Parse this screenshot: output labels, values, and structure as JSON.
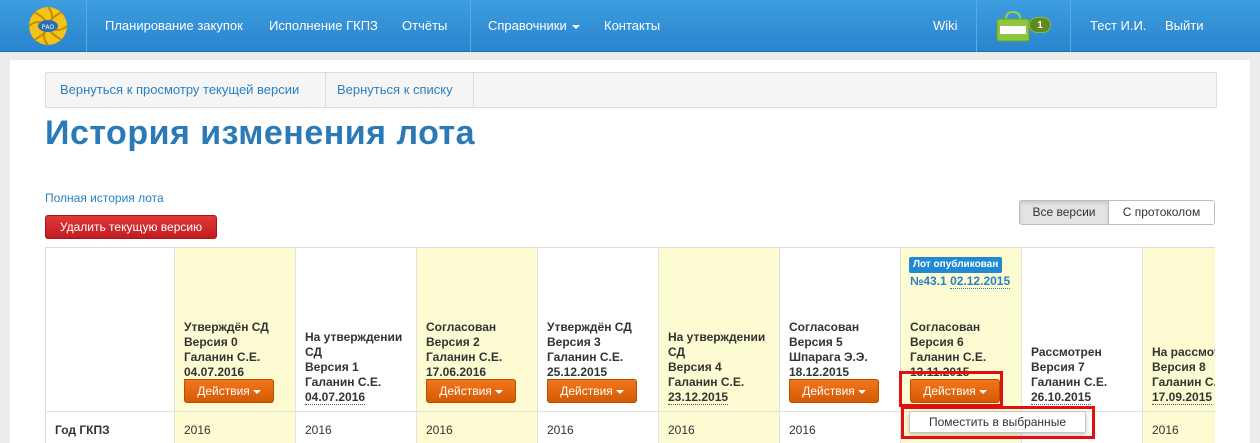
{
  "nav": {
    "items": [
      "Планирование закупок",
      "Исполнение ГКПЗ",
      "Отчёты",
      "Справочники",
      "Контакты"
    ],
    "wiki": "Wiki",
    "cart_count": "1",
    "user": "Тест И.И.",
    "logout": "Выйти",
    "colors": {
      "bar": "#2a85cc",
      "accent": "#5f8a1f"
    }
  },
  "breadcrumbs": [
    "Вернуться к просмотру текущей версии",
    "Вернуться к списку"
  ],
  "page": {
    "title": "История изменения лота",
    "history_link": "Полная история лота",
    "delete_button": "Удалить текущую версию",
    "filter": {
      "all": "Все версии",
      "with_protocol": "С протоколом",
      "selected": "Все версии"
    }
  },
  "table": {
    "row_label": "Год ГКПЗ",
    "actions_label": "Действия",
    "published": {
      "badge": "Лот опубликован",
      "number": "№43.1",
      "date": "02.12.2015"
    },
    "versions": [
      {
        "status": "Утверждён СД",
        "version": "Версия 0",
        "author": "Галанин С.Е.",
        "date": "04.07.2016",
        "year": "2016"
      },
      {
        "status": "На утверждении СД",
        "version": "Версия 1",
        "author": "Галанин С.Е.",
        "date": "04.07.2016",
        "year": "2016"
      },
      {
        "status": "Согласован",
        "version": "Версия 2",
        "author": "Галанин С.Е.",
        "date": "17.06.2016",
        "year": "2016"
      },
      {
        "status": "Утверждён СД",
        "version": "Версия 3",
        "author": "Галанин С.Е.",
        "date": "25.12.2015",
        "year": "2016"
      },
      {
        "status": "На утверждении СД",
        "version": "Версия 4",
        "author": "Галанин С.Е.",
        "date": "23.12.2015",
        "year": "2016"
      },
      {
        "status": "Согласован",
        "version": "Версия 5",
        "author": "Шпарага Э.Э.",
        "date": "18.12.2015",
        "year": "2016"
      },
      {
        "status": "Согласован",
        "version": "Версия 6",
        "author": "Галанин С.Е.",
        "date": "13.11.2015",
        "year": ""
      },
      {
        "status": "Рассмотрен",
        "version": "Версия 7",
        "author": "Галанин С.Е.",
        "date": "26.10.2015",
        "year": ""
      },
      {
        "status": "На рассмотрении",
        "version": "Версия 8",
        "author": "Галанин С.Е.",
        "date": "17.09.2015",
        "year": "2016"
      }
    ]
  },
  "dropdown": {
    "item": "Поместить в выбранные"
  }
}
